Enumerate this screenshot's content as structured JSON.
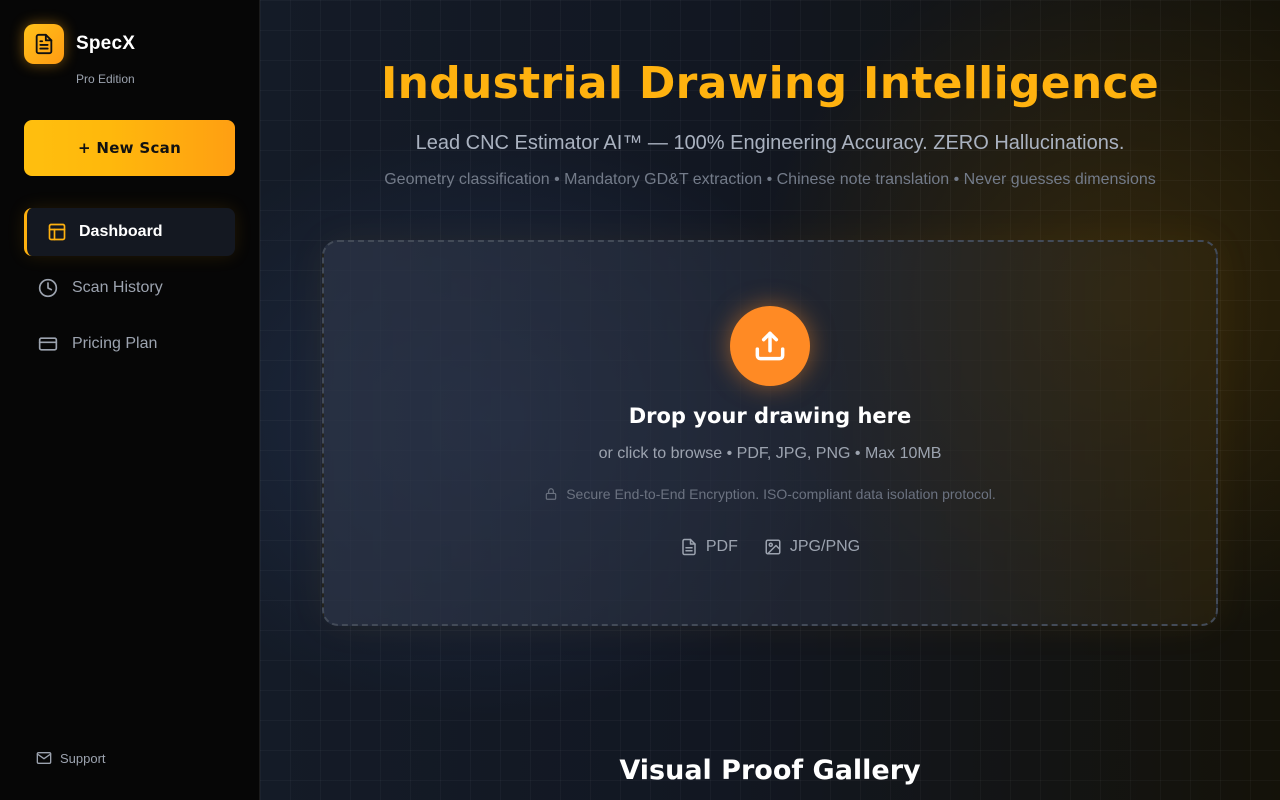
{
  "brand": {
    "name": "SpecX",
    "edition": "Pro Edition",
    "logo_icon": "document-icon"
  },
  "sidebar": {
    "new_scan_label": "+ New Scan",
    "items": [
      {
        "label": "Dashboard",
        "icon": "layout-icon",
        "active": true
      },
      {
        "label": "Scan History",
        "icon": "clock-icon",
        "active": false
      },
      {
        "label": "Pricing Plan",
        "icon": "credit-card-icon",
        "active": false
      }
    ],
    "support_label": "Support"
  },
  "hero": {
    "title": "Industrial Drawing Intelligence",
    "subtitle": "Lead CNC Estimator AI™ — 100% Engineering Accuracy. ZERO Hallucinations.",
    "tags": "Geometry classification • Mandatory GD&T extraction • Chinese note translation • Never guesses dimensions"
  },
  "dropzone": {
    "title": "Drop your drawing here",
    "subtitle": "or click to browse • PDF, JPG, PNG • Max 10MB",
    "secure_text": "Secure End-to-End Encryption. ISO-compliant data isolation protocol.",
    "formats": [
      {
        "label": "PDF",
        "icon": "file-icon"
      },
      {
        "label": "JPG/PNG",
        "icon": "image-icon"
      }
    ]
  },
  "gallery": {
    "title": "Visual Proof Gallery"
  },
  "colors": {
    "accent": "#ffb20f",
    "upload": "#ff8a24",
    "background": "#0a0a0a"
  }
}
